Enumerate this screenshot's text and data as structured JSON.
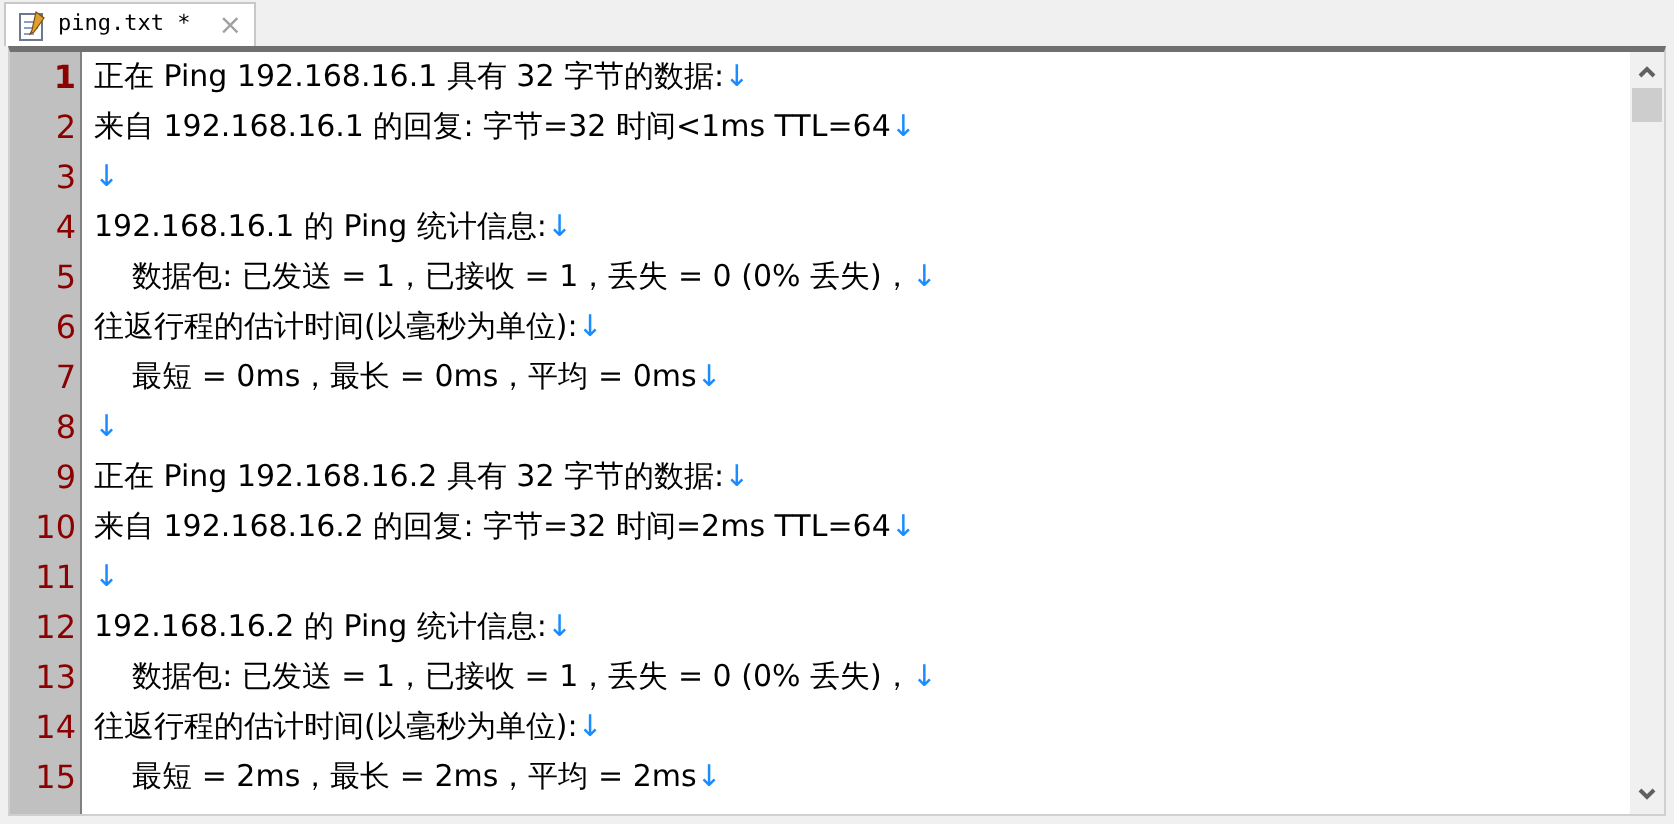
{
  "tabs": [
    {
      "label": "ping.txt *",
      "selected": true,
      "close": "×"
    }
  ],
  "lines": [
    {
      "number": "1",
      "text": "正在 Ping 192.168.16.1 具有 32 字节的数据:",
      "eol": "↓",
      "current": true
    },
    {
      "number": "2",
      "text": "来自 192.168.16.1 的回复: 字节=32 时间<1ms TTL=64",
      "eol": "↓",
      "current": false
    },
    {
      "number": "3",
      "eol": "↓",
      "current": false
    },
    {
      "number": "4",
      "text": "192.168.16.1 的 Ping 统计信息:",
      "eol": "↓",
      "current": false
    },
    {
      "number": "5",
      "text": "    数据包: 已发送 = 1，已接收 = 1，丢失 = 0 (0% 丢失)，",
      "eol": "↓",
      "current": false
    },
    {
      "number": "6",
      "text": "往返行程的估计时间(以毫秒为单位):",
      "eol": "↓",
      "current": false
    },
    {
      "number": "7",
      "text": "    最短 = 0ms，最长 = 0ms，平均 = 0ms",
      "eol": "↓",
      "current": false
    },
    {
      "number": "8",
      "eol": "↓",
      "current": false
    },
    {
      "number": "9",
      "text": "正在 Ping 192.168.16.2 具有 32 字节的数据:",
      "eol": "↓",
      "current": false
    },
    {
      "number": "10",
      "text": "来自 192.168.16.2 的回复: 字节=32 时间=2ms TTL=64",
      "eol": "↓",
      "current": false
    },
    {
      "number": "11",
      "eol": "↓",
      "current": false
    },
    {
      "number": "12",
      "text": "192.168.16.2 的 Ping 统计信息:",
      "eol": "↓",
      "current": false
    },
    {
      "number": "13",
      "text": "    数据包: 已发送 = 1，已接收 = 1，丢失 = 0 (0% 丢失)，",
      "eol": "↓",
      "current": false
    },
    {
      "number": "14",
      "text": "往返行程的估计时间(以毫秒为单位):",
      "eol": "↓",
      "current": false
    },
    {
      "number": "15",
      "text": "    最短 = 2ms，最长 = 2ms，平均 = 2ms",
      "eol": "↓",
      "current": false
    }
  ]
}
